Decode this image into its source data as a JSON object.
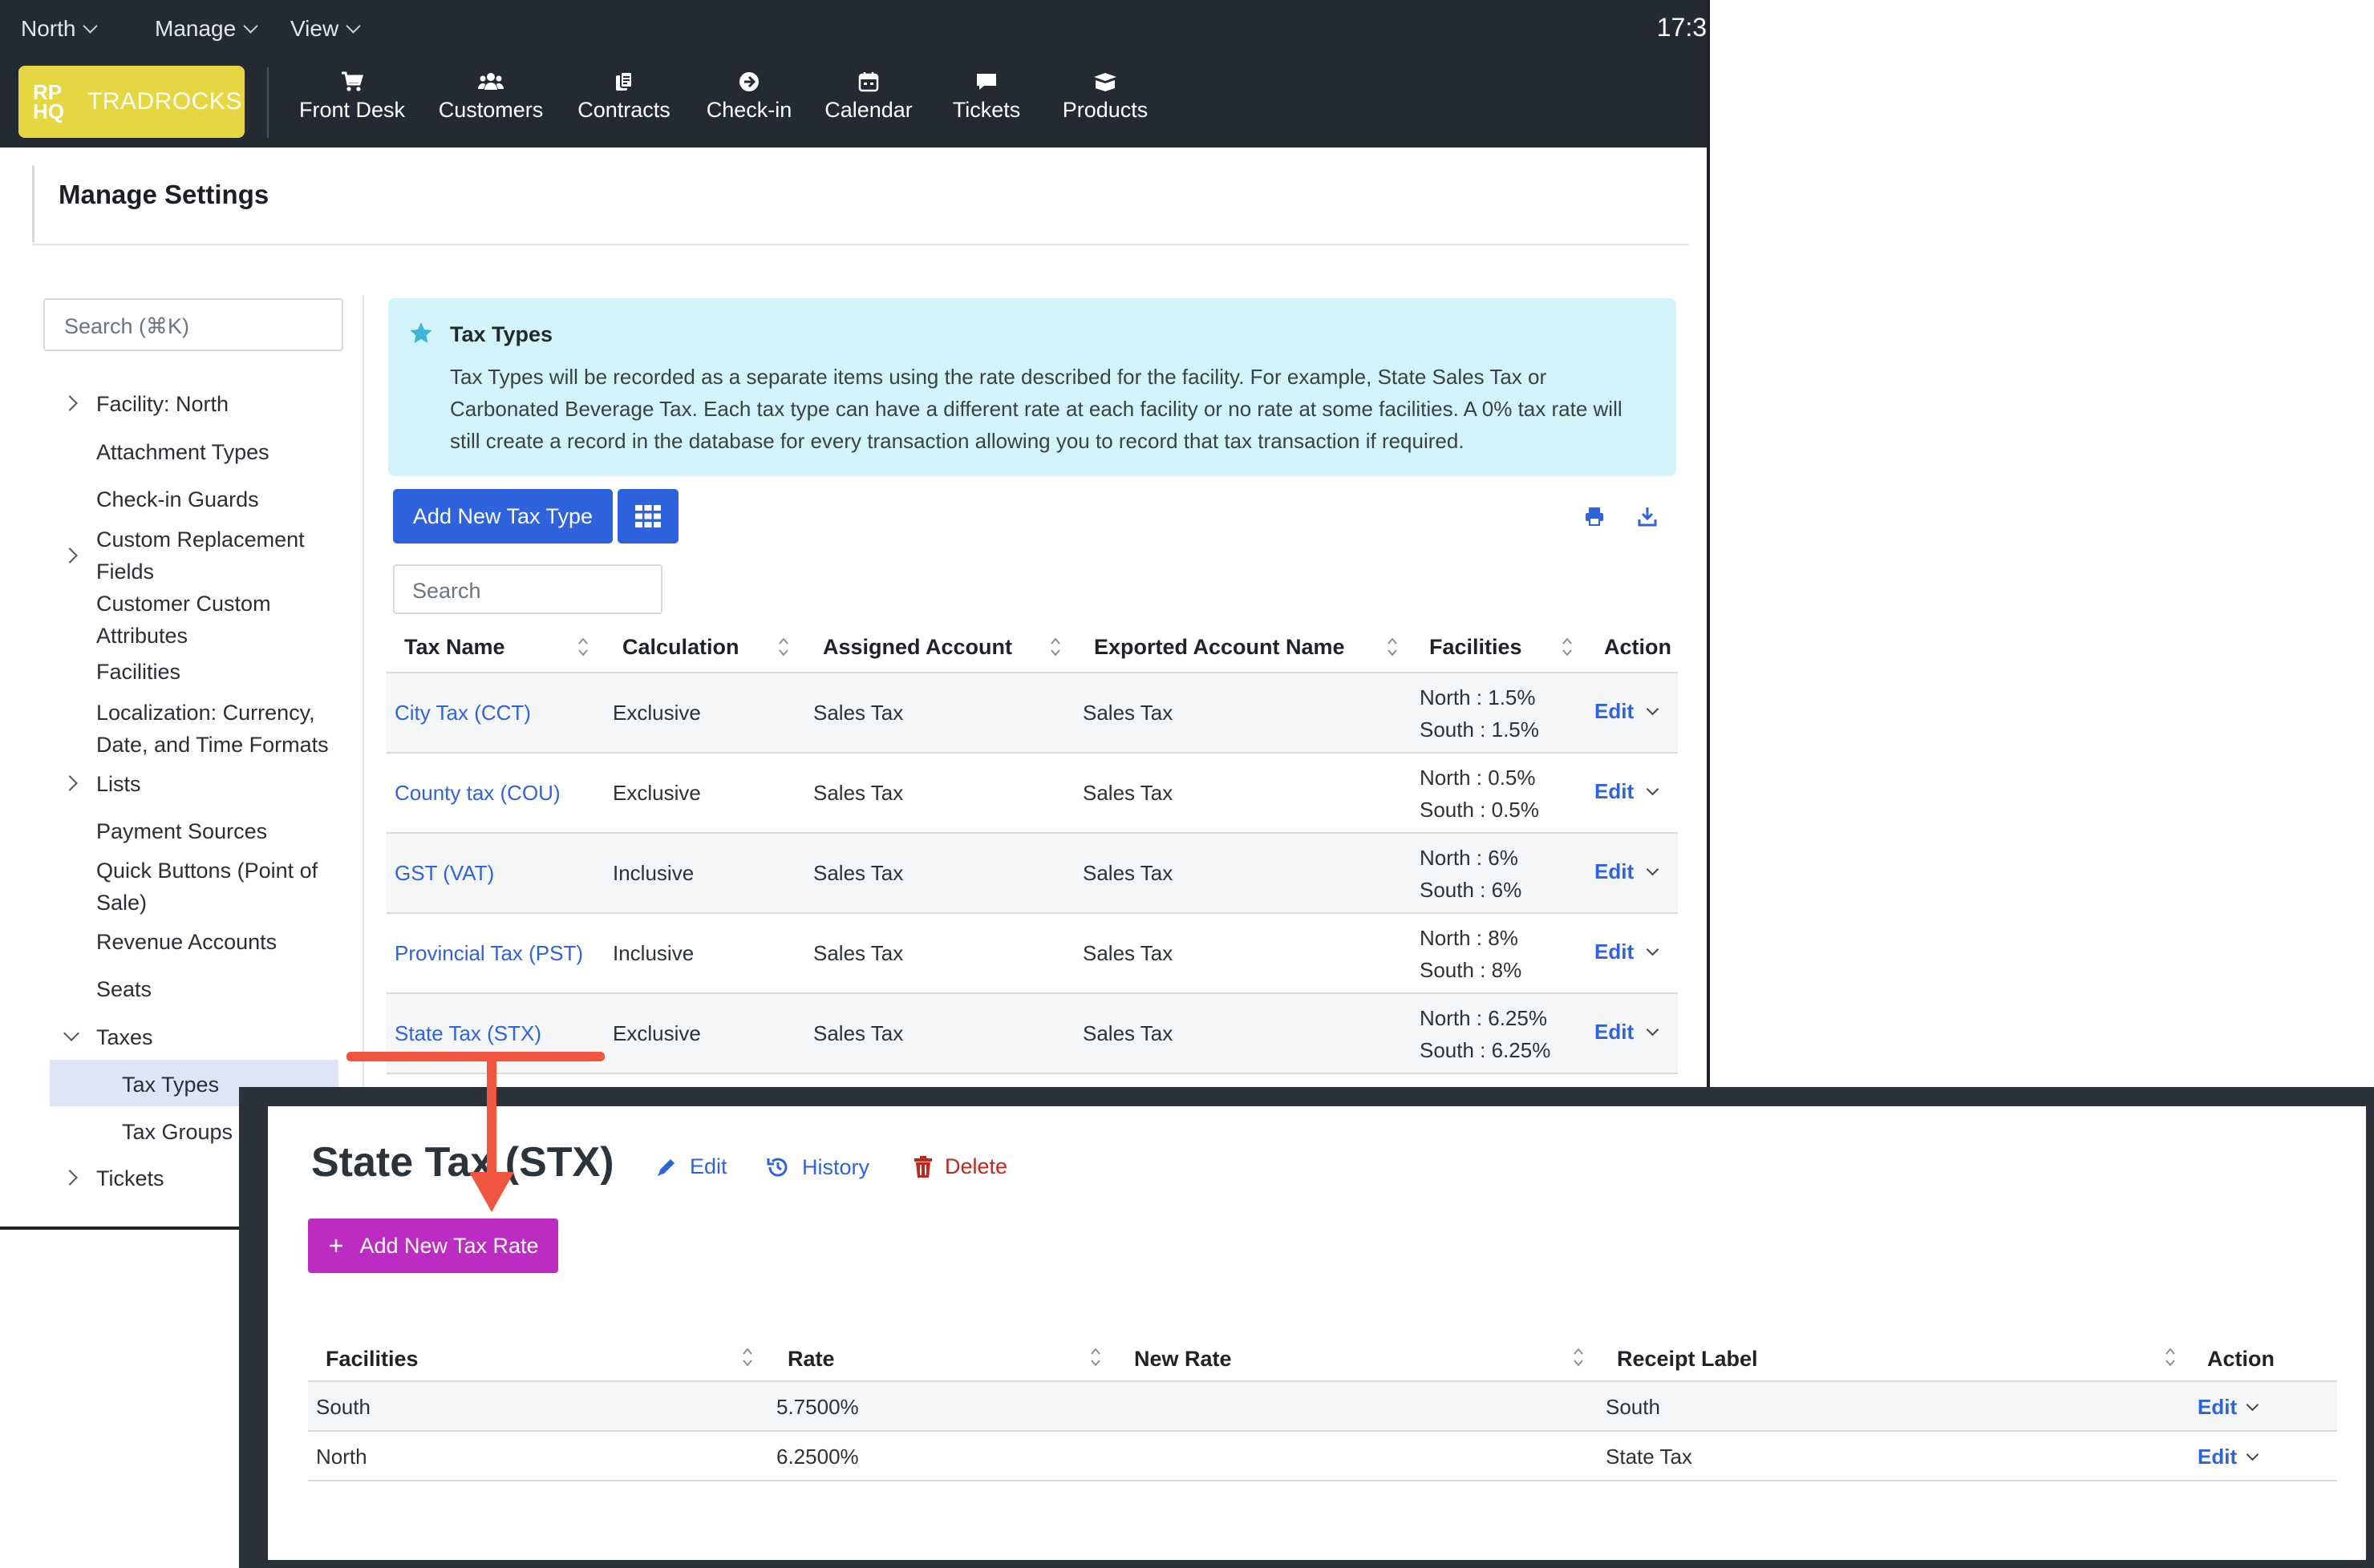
{
  "menubar": {
    "facility_menu": "North",
    "manage_menu": "Manage",
    "view_menu": "View",
    "clock": "17:3"
  },
  "logo": {
    "mark": "RP HQ",
    "brand": "TRADROCKS"
  },
  "nav": {
    "items": [
      {
        "label": "Front Desk",
        "icon": "cart-icon"
      },
      {
        "label": "Customers",
        "icon": "users-icon"
      },
      {
        "label": "Contracts",
        "icon": "contracts-icon"
      },
      {
        "label": "Check-in",
        "icon": "arrow-circle-icon"
      },
      {
        "label": "Calendar",
        "icon": "calendar-icon"
      },
      {
        "label": "Tickets",
        "icon": "chat-icon"
      },
      {
        "label": "Products",
        "icon": "box-icon"
      }
    ]
  },
  "page": {
    "title": "Manage Settings"
  },
  "sidebar": {
    "search_placeholder": "Search (⌘K)",
    "items": [
      {
        "label": "Facility: North",
        "expandable": true
      },
      {
        "label": "Attachment Types"
      },
      {
        "label": "Check-in Guards"
      },
      {
        "label": "Custom Replacement Fields",
        "expandable": true
      },
      {
        "label": "Customer Custom Attributes"
      },
      {
        "label": "Facilities"
      },
      {
        "label": "Localization: Currency, Date, and Time Formats"
      },
      {
        "label": "Lists",
        "expandable": true
      },
      {
        "label": "Payment Sources"
      },
      {
        "label": "Quick Buttons (Point of Sale)"
      },
      {
        "label": "Revenue Accounts"
      },
      {
        "label": "Seats"
      },
      {
        "label": "Taxes",
        "expanded": true
      },
      {
        "label": "Tax Types",
        "active": true
      },
      {
        "label": "Tax Groups"
      },
      {
        "label": "Tickets",
        "expandable": true
      }
    ]
  },
  "info": {
    "title": "Tax Types",
    "description": "Tax Types will be recorded as a separate items using the rate described for the facility. For example, State Sales Tax or Carbonated Beverage Tax. Each tax type can have a different rate at each facility or no rate at some facilities. A 0% tax rate will still create a record in the database for every transaction allowing you to record that tax transaction if required."
  },
  "toolbar": {
    "add_label": "Add New Tax Type",
    "search_placeholder": "Search"
  },
  "table": {
    "columns": [
      "Tax Name",
      "Calculation",
      "Assigned Account",
      "Exported Account Name",
      "Facilities",
      "Action"
    ],
    "rows": [
      {
        "name": "City Tax (CCT)",
        "calc": "Exclusive",
        "assigned": "Sales Tax",
        "exported": "Sales Tax",
        "fac1": "North : 1.5%",
        "fac2": "South : 1.5%",
        "action": "Edit"
      },
      {
        "name": "County tax (COU)",
        "calc": "Exclusive",
        "assigned": "Sales Tax",
        "exported": "Sales Tax",
        "fac1": "North : 0.5%",
        "fac2": "South : 0.5%",
        "action": "Edit"
      },
      {
        "name": "GST (VAT)",
        "calc": "Inclusive",
        "assigned": "Sales Tax",
        "exported": "Sales Tax",
        "fac1": "North : 6%",
        "fac2": "South : 6%",
        "action": "Edit"
      },
      {
        "name": "Provincial Tax (PST)",
        "calc": "Inclusive",
        "assigned": "Sales Tax",
        "exported": "Sales Tax",
        "fac1": "North : 8%",
        "fac2": "South : 8%",
        "action": "Edit"
      },
      {
        "name": "State Tax (STX)",
        "calc": "Exclusive",
        "assigned": "Sales Tax",
        "exported": "Sales Tax",
        "fac1": "North : 6.25%",
        "fac2": "South : 6.25%",
        "action": "Edit"
      }
    ]
  },
  "detail": {
    "title": "State Tax (STX)",
    "edit_label": "Edit",
    "history_label": "History",
    "delete_label": "Delete",
    "add_rate_label": "Add New Tax Rate",
    "columns": [
      "Facilities",
      "Rate",
      "New Rate",
      "Receipt Label",
      "Action"
    ],
    "rows": [
      {
        "facility": "South",
        "rate": "5.7500%",
        "new_rate": "",
        "receipt_label": "South",
        "action": "Edit"
      },
      {
        "facility": "North",
        "rate": "6.2500%",
        "new_rate": "",
        "receipt_label": "State Tax",
        "action": "Edit"
      }
    ]
  },
  "colors": {
    "primary": "#2f63de",
    "accent_purple": "#bd2cc2",
    "logo_yellow": "#e6d642",
    "navbar": "#232a31",
    "info_bg": "#d2f4f9",
    "delete_red": "#c0271d",
    "arrow": "#f0563f"
  }
}
